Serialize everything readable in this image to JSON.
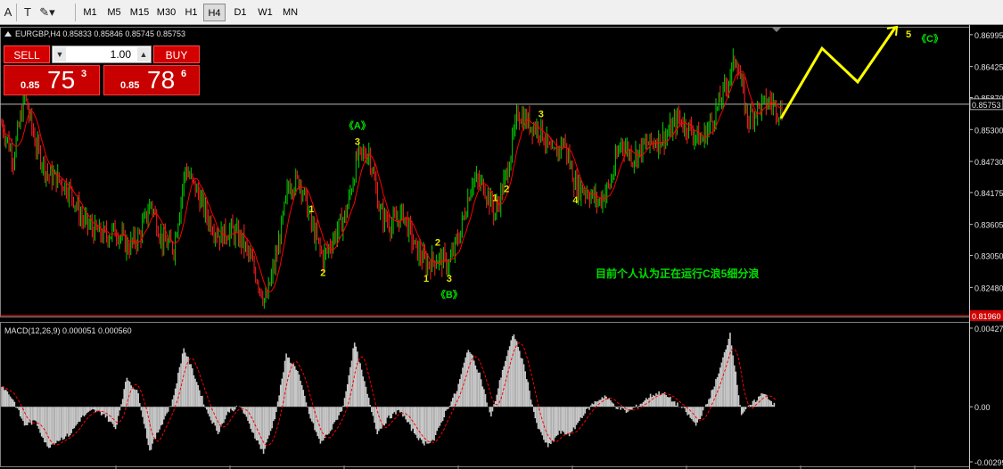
{
  "toolbar": {
    "timeframes": [
      {
        "label": "M1",
        "active": false
      },
      {
        "label": "M5",
        "active": false
      },
      {
        "label": "M15",
        "active": false
      },
      {
        "label": "M30",
        "active": false
      },
      {
        "label": "H1",
        "active": false
      },
      {
        "label": "H4",
        "active": true
      },
      {
        "label": "D1",
        "active": false
      },
      {
        "label": "W1",
        "active": false
      },
      {
        "label": "MN",
        "active": false
      }
    ],
    "icons": [
      "text-label-icon",
      "cursor-tool-icon",
      "shapes-dropdown-icon"
    ]
  },
  "symbol_info": "EURGBP,H4  0.85833 0.85846 0.85745 0.85753",
  "trade_panel": {
    "sell_label": "SELL",
    "buy_label": "BUY",
    "lot_value": "1.00",
    "sell_price": {
      "prefix": "0.85",
      "big": "75",
      "sup": "3"
    },
    "buy_price": {
      "prefix": "0.85",
      "big": "78",
      "sup": "6"
    }
  },
  "chart_data": [
    {
      "type": "line",
      "title": "EURGBP,H4",
      "ylim": [
        0.8196,
        0.8712
      ],
      "y_ticks": [
        "0.86995",
        "0.86425",
        "0.85870",
        "0.85300",
        "0.84730",
        "0.84175",
        "0.83605",
        "0.83050",
        "0.82480"
      ],
      "current_price_label": "0.85753",
      "low_price_label": "0.81960",
      "current_price": 0.85753,
      "low_price": 0.8196,
      "path": [
        0.854,
        0.848,
        0.859,
        0.85,
        0.845,
        0.844,
        0.842,
        0.837,
        0.835,
        0.834,
        0.835,
        0.832,
        0.834,
        0.84,
        0.833,
        0.832,
        0.846,
        0.842,
        0.837,
        0.834,
        0.835,
        0.833,
        0.828,
        0.822,
        0.831,
        0.843,
        0.844,
        0.836,
        0.83,
        0.834,
        0.838,
        0.848,
        0.849,
        0.838,
        0.836,
        0.838,
        0.832,
        0.829,
        0.83,
        0.829,
        0.835,
        0.844,
        0.843,
        0.838,
        0.845,
        0.856,
        0.854,
        0.853,
        0.848,
        0.851,
        0.843,
        0.842,
        0.84,
        0.843,
        0.851,
        0.848,
        0.85,
        0.851,
        0.852,
        0.855,
        0.853,
        0.851,
        0.855,
        0.86,
        0.866,
        0.855,
        0.857,
        0.858,
        0.856
      ],
      "projection": [
        0.855,
        0.8675,
        0.8615,
        0.8712
      ],
      "wave_labels": [
        {
          "text": "1",
          "idx": 27,
          "side": "above"
        },
        {
          "text": "2",
          "idx": 28,
          "side": "below"
        },
        {
          "text": "3",
          "idx": 31,
          "side": "above"
        },
        {
          "text": "《A》",
          "idx": 31,
          "side": "above2"
        },
        {
          "text": "1",
          "idx": 37,
          "side": "below"
        },
        {
          "text": "2",
          "idx": 38,
          "side": "above"
        },
        {
          "text": "3",
          "idx": 39,
          "side": "below"
        },
        {
          "text": "《B》",
          "idx": 39,
          "side": "below2"
        },
        {
          "text": "1",
          "idx": 43,
          "side": "above"
        },
        {
          "text": "2",
          "idx": 44,
          "side": "below"
        },
        {
          "text": "3",
          "idx": 47,
          "side": "above"
        },
        {
          "text": "4",
          "idx": 50,
          "side": "below"
        },
        {
          "text": "5",
          "proj": 3,
          "side": "right"
        },
        {
          "text": "《C》",
          "proj": 3,
          "side": "right2"
        }
      ],
      "annotation": "目前个人认为正在运行C浪5细分浪",
      "colors": {
        "up": "#00d000",
        "down": "#ff2020",
        "ma": "#ff0000",
        "projection": "#ffff00",
        "labels": "#e8e800",
        "labels_green": "#00e000",
        "grid": "#303030"
      }
    },
    {
      "type": "area",
      "title": "MACD(12,26,9) 0.000051 0.000560",
      "ylim": [
        -0.00299,
        0.00427
      ],
      "y_ticks": [
        "0.00427",
        "0.00",
        "-0.00299"
      ],
      "values": [
        0.0012,
        0.0004,
        -0.001,
        -0.0008,
        -0.0022,
        -0.0018,
        -0.0015,
        -0.0006,
        -0.0002,
        -0.0004,
        -0.0012,
        0.0016,
        0.0007,
        -0.0024,
        -0.001,
        0.0003,
        0.0032,
        0.0016,
        -0.0002,
        -0.0014,
        -0.0002,
        0.0,
        -0.0013,
        -0.0025,
        -0.0006,
        0.0028,
        0.002,
        -0.0004,
        -0.002,
        -0.0012,
        0.0,
        0.0035,
        0.001,
        -0.0014,
        -0.0006,
        -0.0002,
        -0.0012,
        -0.002,
        -0.0018,
        -0.0003,
        0.0009,
        0.0032,
        0.0018,
        -0.0006,
        0.002,
        0.004,
        0.002,
        -0.001,
        -0.0022,
        -0.0014,
        -0.0015,
        -0.0005,
        0.0002,
        0.0006,
        0.0,
        -0.0003,
        0.0001,
        0.0006,
        0.0008,
        0.0003,
        -0.0002,
        -0.001,
        0.0002,
        0.0018,
        0.004,
        -0.0004,
        0.0002,
        0.0008,
        0.0
      ],
      "colors": {
        "hist": "#c8c8c8",
        "signal": "#ff0000",
        "grid": "#303030"
      }
    }
  ]
}
